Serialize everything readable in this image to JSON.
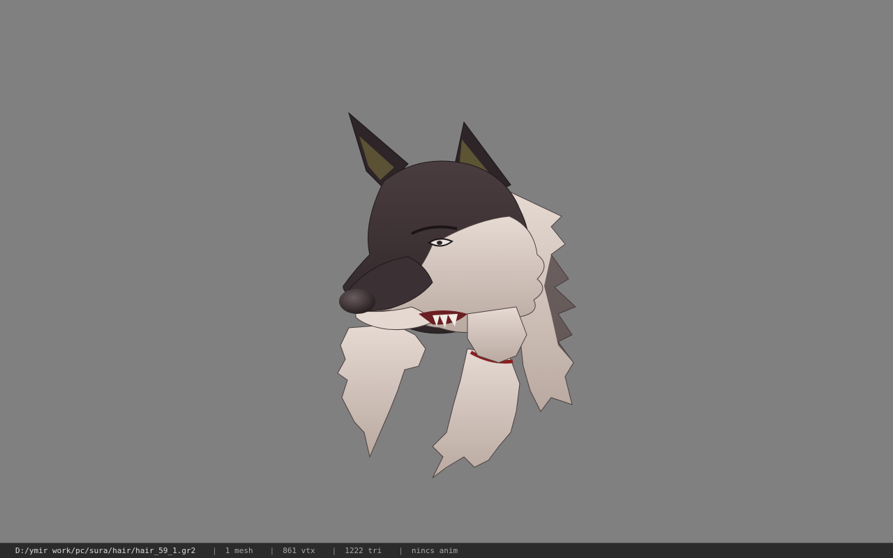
{
  "viewer": {
    "background_color": "#808080",
    "model_name": "wolf-head-hair-mesh"
  },
  "status_bar": {
    "file_path": "D:/ymir work/pc/sura/hair/hair_59_1.gr2",
    "separator": "|",
    "mesh_count": "1 mesh",
    "vertex_count": "861 vtx",
    "triangle_count": "1222 tri",
    "anim_status": "nincs anim"
  }
}
